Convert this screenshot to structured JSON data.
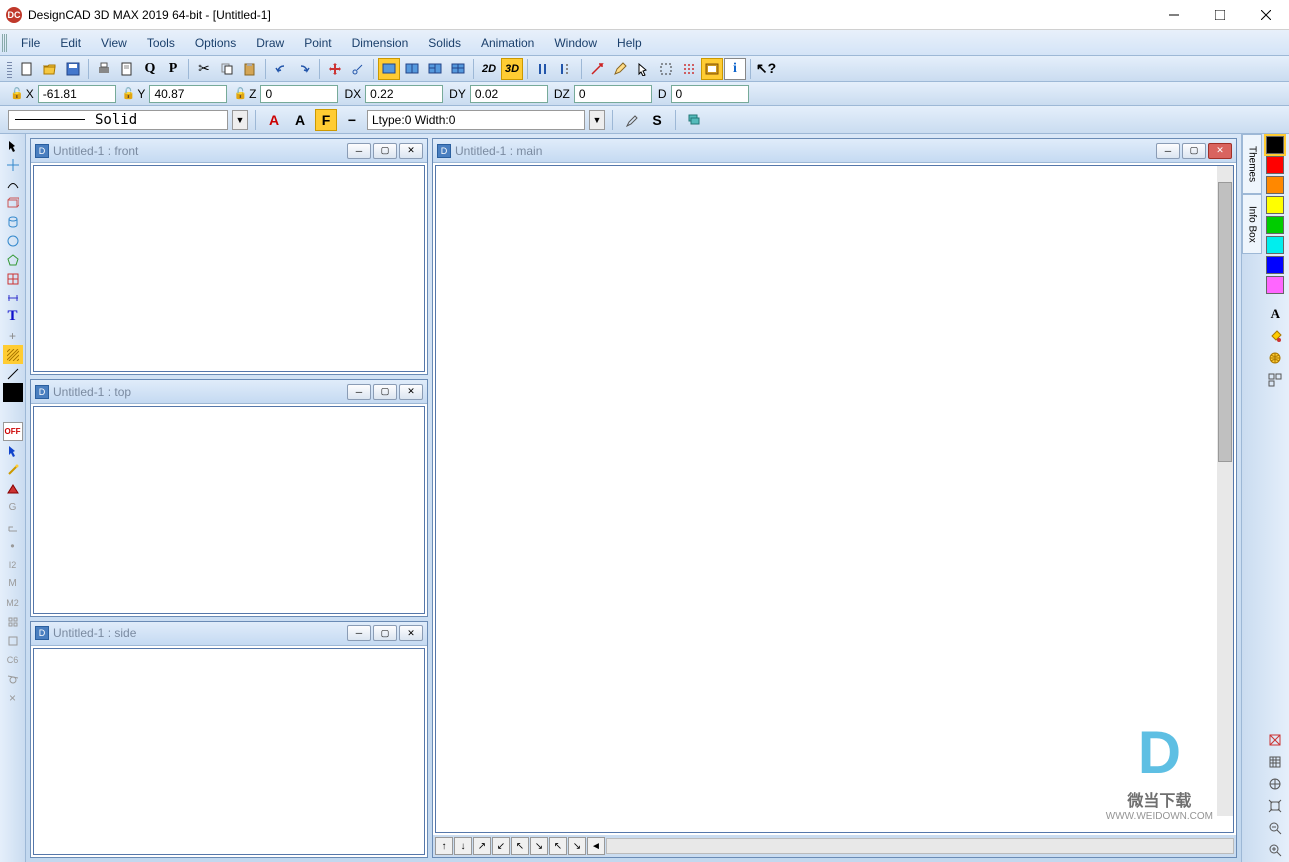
{
  "app": {
    "icon_text": "DC",
    "title": "DesignCAD 3D MAX 2019 64-bit - [Untitled-1]"
  },
  "menu": [
    "File",
    "Edit",
    "View",
    "Tools",
    "Options",
    "Draw",
    "Point",
    "Dimension",
    "Solids",
    "Animation",
    "Window",
    "Help"
  ],
  "coords": {
    "x_label": "X",
    "x": "-61.81",
    "y_label": "Y",
    "y": "40.87",
    "z_label": "Z",
    "z": "0",
    "dx_label": "DX",
    "dx": "0.22",
    "dy_label": "DY",
    "dy": "0.02",
    "dz_label": "DZ",
    "dz": "0",
    "d_label": "D",
    "d": "0"
  },
  "style": {
    "line_name": "Solid",
    "ltype": "Ltype:0  Width:0",
    "mode_2d": "2D",
    "mode_3d": "3D"
  },
  "panels": {
    "front": "Untitled-1 : front",
    "top": "Untitled-1 : top",
    "side": "Untitled-1 : side",
    "main": "Untitled-1 : main"
  },
  "side_tabs": [
    "Themes",
    "Info Box"
  ],
  "palette": [
    "#000000",
    "#ff0000",
    "#ff8800",
    "#ffff00",
    "#00cc00",
    "#00eeee",
    "#0000ff",
    "#ff00ff"
  ],
  "left_tools": {
    "off": "OFF",
    "g": "G",
    "i2": "I2",
    "m": "M",
    "m2": "M2",
    "c6": "C6"
  },
  "watermark": {
    "text1": "微当下载",
    "text2": "WWW.WEIDOWN.COM"
  }
}
